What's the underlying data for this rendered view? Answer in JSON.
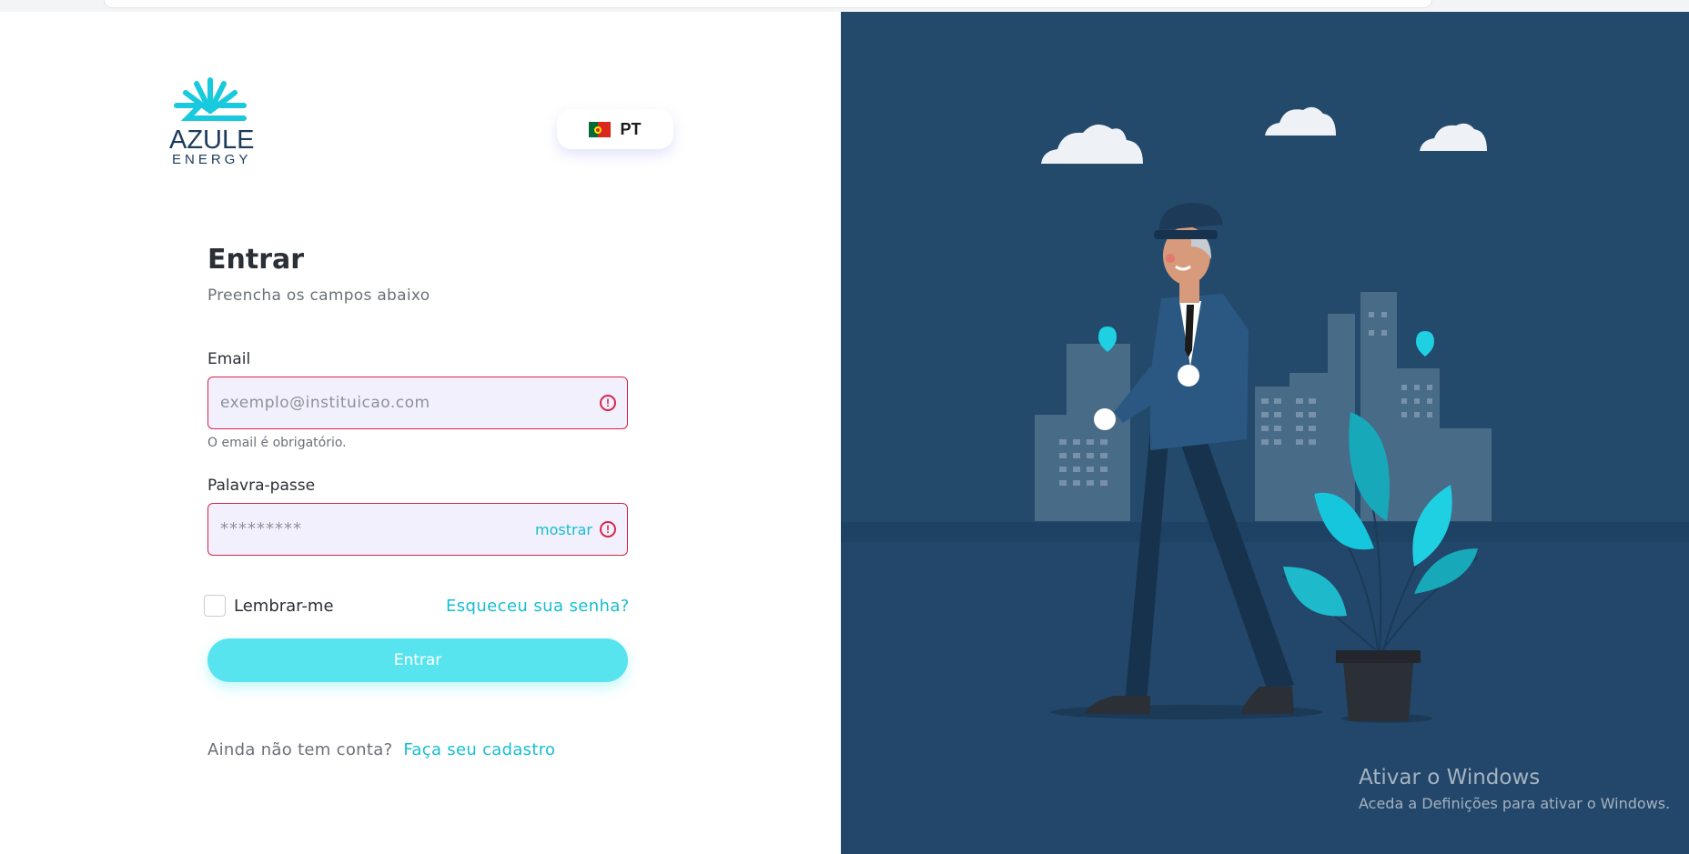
{
  "logo": {
    "word": "AZULE",
    "sub": "ENERGY"
  },
  "language": {
    "code": "PT",
    "flag_icon": "portugal-flag-icon"
  },
  "form": {
    "title": "Entrar",
    "subtitle": "Preencha os campos abaixo",
    "email": {
      "label": "Email",
      "value": "",
      "placeholder": "exemplo@instituicao.com",
      "error": "O email é obrigatório."
    },
    "password": {
      "label": "Palavra-passe",
      "placeholder": "*********",
      "show_label": "mostrar"
    },
    "remember_label": "Lembrar-me",
    "remember_checked": false,
    "forgot_label": "Esqueceu sua senha?",
    "submit_label": "Entrar",
    "signup_question": "Ainda não tem conta?",
    "signup_link": "Faça seu cadastro"
  },
  "watermark": {
    "title": "Ativar o Windows",
    "subtitle": "Aceda a Definições para ativar o Windows."
  },
  "colors": {
    "accent": "#15bed0",
    "button": "#58e4ef",
    "error": "#d6264a",
    "panel": "#23496b",
    "input_bg": "#f1f0fc"
  }
}
